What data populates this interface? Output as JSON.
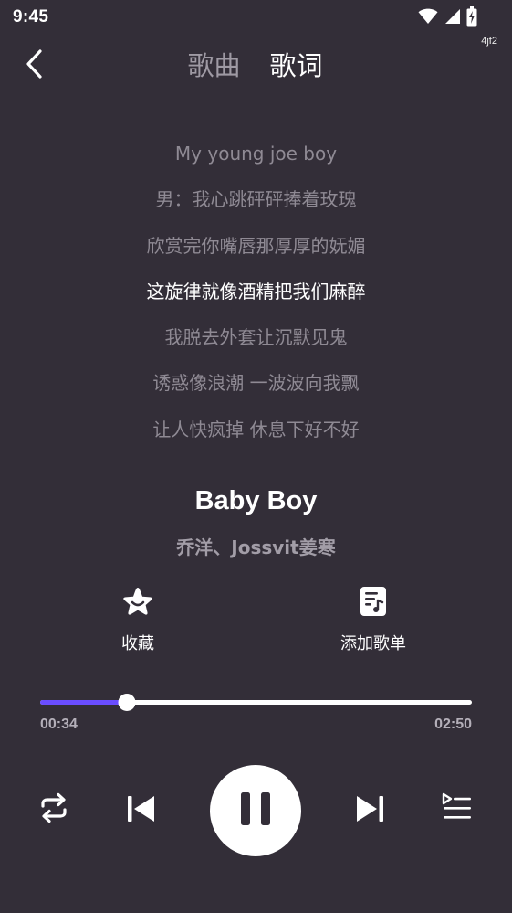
{
  "status_bar": {
    "time": "9:45",
    "icons": [
      "wifi-icon",
      "signal-icon",
      "battery-charging-icon"
    ]
  },
  "build_tag": "4jf2",
  "header": {
    "back_icon": "back-arrow-icon",
    "tabs": [
      {
        "label": "歌曲",
        "active": false
      },
      {
        "label": "歌词",
        "active": true
      }
    ]
  },
  "lyrics": {
    "lines": [
      "My young joe boy",
      "男：我心跳砰砰捧着玫瑰",
      "欣赏完你嘴唇那厚厚的妩媚",
      "这旋律就像酒精把我们麻醉",
      "我脱去外套让沉默见鬼",
      "诱惑像浪潮 一波波向我飘",
      "让人快疯掉 休息下好不好"
    ],
    "current_index": 3
  },
  "song": {
    "title": "Baby Boy",
    "artist": "乔洋、Jossvit姜寒"
  },
  "actions": {
    "favorite_label": "收藏",
    "favorite_icon": "star-icon",
    "add_playlist_label": "添加歌单",
    "add_playlist_icon": "music-note-list-icon"
  },
  "progress": {
    "elapsed": "00:34",
    "total": "02:50",
    "fraction": 0.2,
    "fill_color": "#6a4dff"
  },
  "controls": {
    "repeat_icon": "repeat-icon",
    "previous_icon": "skip-previous-icon",
    "play_pause_icon": "pause-icon",
    "next_icon": "skip-next-icon",
    "queue_icon": "playlist-queue-icon"
  },
  "colors": {
    "background": "#332e38",
    "accent": "#6a4dff",
    "inactive_text": "#8f8a94"
  }
}
